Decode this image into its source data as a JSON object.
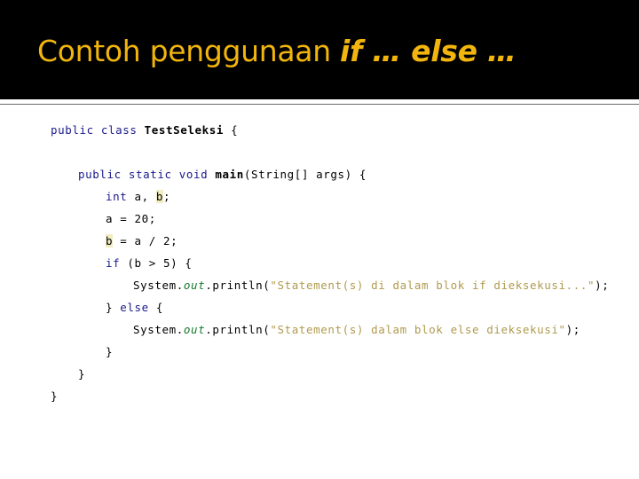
{
  "slide": {
    "title_prefix": "Contoh penggunaan ",
    "title_emphasis": "if … else …",
    "title_full": "Contoh penggunaan if … else …",
    "accent_color": "#F2B50D",
    "header_background": "#000000",
    "rule_color": "#6b6b6b",
    "body_background": "#ffffff"
  },
  "code": {
    "language": "Java",
    "keyword_color": "#1a1a8c",
    "string_color": "#B09A4E",
    "field_color": "#157A2E",
    "highlight_color": "#F0EDC2",
    "lines": [
      {
        "indent": 0,
        "tokens": [
          {
            "text": "public class ",
            "kind": "keyword"
          },
          {
            "text": "TestSeleksi",
            "kind": "bold-identifier"
          },
          {
            "text": " {",
            "kind": "plain"
          }
        ]
      },
      {
        "indent": 0,
        "tokens": []
      },
      {
        "indent": 1,
        "tokens": [
          {
            "text": "public static void ",
            "kind": "keyword"
          },
          {
            "text": "main",
            "kind": "bold-identifier"
          },
          {
            "text": "(String[] args) {",
            "kind": "plain"
          }
        ]
      },
      {
        "indent": 2,
        "tokens": [
          {
            "text": "int",
            "kind": "keyword"
          },
          {
            "text": " a, ",
            "kind": "plain"
          },
          {
            "text": "b",
            "kind": "highlight"
          },
          {
            "text": ";",
            "kind": "plain"
          }
        ]
      },
      {
        "indent": 2,
        "tokens": [
          {
            "text": "a = 20;",
            "kind": "plain"
          }
        ]
      },
      {
        "indent": 2,
        "tokens": [
          {
            "text": "b",
            "kind": "highlight"
          },
          {
            "text": " = a / 2;",
            "kind": "plain"
          }
        ]
      },
      {
        "indent": 2,
        "tokens": [
          {
            "text": "if",
            "kind": "keyword"
          },
          {
            "text": " (b > 5) {",
            "kind": "plain"
          }
        ]
      },
      {
        "indent": 3,
        "tokens": [
          {
            "text": "System.",
            "kind": "plain"
          },
          {
            "text": "out",
            "kind": "field"
          },
          {
            "text": ".println(",
            "kind": "plain"
          },
          {
            "text": "\"Statement(s) di dalam blok if dieksekusi...\"",
            "kind": "string"
          },
          {
            "text": ");",
            "kind": "plain"
          }
        ]
      },
      {
        "indent": 2,
        "tokens": [
          {
            "text": "} ",
            "kind": "plain"
          },
          {
            "text": "else",
            "kind": "keyword"
          },
          {
            "text": " {",
            "kind": "plain"
          }
        ]
      },
      {
        "indent": 3,
        "tokens": [
          {
            "text": "System.",
            "kind": "plain"
          },
          {
            "text": "out",
            "kind": "field"
          },
          {
            "text": ".println(",
            "kind": "plain"
          },
          {
            "text": "\"Statement(s) dalam blok else dieksekusi\"",
            "kind": "string"
          },
          {
            "text": ");",
            "kind": "plain"
          }
        ]
      },
      {
        "indent": 2,
        "tokens": [
          {
            "text": "}",
            "kind": "plain"
          }
        ]
      },
      {
        "indent": 1,
        "tokens": [
          {
            "text": "}",
            "kind": "plain"
          }
        ]
      },
      {
        "indent": 0,
        "tokens": [
          {
            "text": "}",
            "kind": "plain"
          }
        ]
      }
    ]
  }
}
